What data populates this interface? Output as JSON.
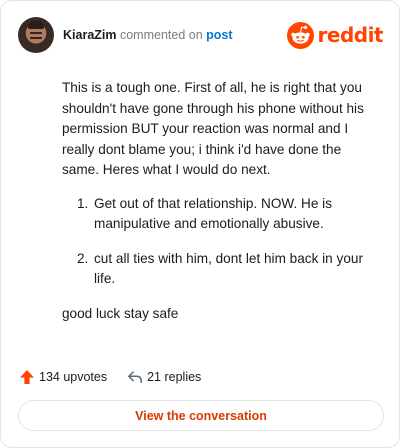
{
  "header": {
    "username": "KiaraZim",
    "action_text": "commented on",
    "post_link": "post",
    "logo_text": "reddit"
  },
  "comment": {
    "intro": "This is a tough one. First of all, he is right that you shouldn't have gone through his phone without his permission BUT your reaction was normal and I really dont blame you; i think i'd have done the same. Heres what I would do next.",
    "list": [
      {
        "number": "1.",
        "text": "Get out of that relationship. NOW. He is manipulative and emotionally abusive."
      },
      {
        "number": "2.",
        "text": "cut all ties with him, dont let him back in your life."
      }
    ],
    "closing": "good luck stay safe"
  },
  "stats": {
    "upvotes": "134 upvotes",
    "replies": "21 replies",
    "upvote_icon": "upvote-arrow-icon",
    "reply_icon": "reply-arrow-icon"
  },
  "cta": {
    "label": "View the conversation"
  },
  "colors": {
    "brand": "#ff4500",
    "link": "#0079d3",
    "cta_text": "#d93a00"
  }
}
